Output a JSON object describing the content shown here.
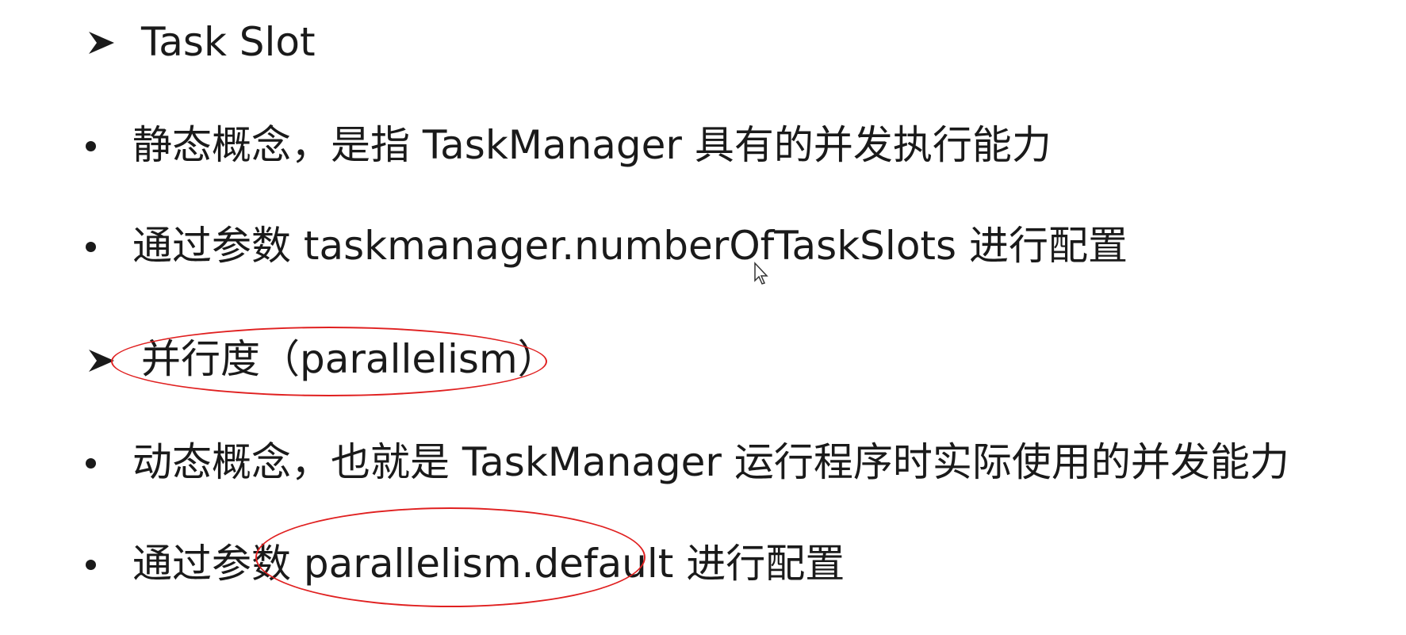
{
  "sections": [
    {
      "heading": "Task Slot",
      "bullets": [
        "静态概念，是指 TaskManager 具有的并发执行能力",
        "通过参数 taskmanager.numberOfTaskSlots 进行配置"
      ]
    },
    {
      "heading": "并行度（parallelism）",
      "bullets": [
        "动态概念，也就是 TaskManager 运行程序时实际使用的并发能力",
        "通过参数 parallelism.default 进行配置"
      ]
    }
  ],
  "icons": {
    "heading_marker": "arrowhead-icon",
    "bullet_marker": "bullet-dot-icon",
    "cursor": "mouse-cursor-icon"
  },
  "colors": {
    "text": "#1a1a1a",
    "annotation": "#e02020"
  }
}
